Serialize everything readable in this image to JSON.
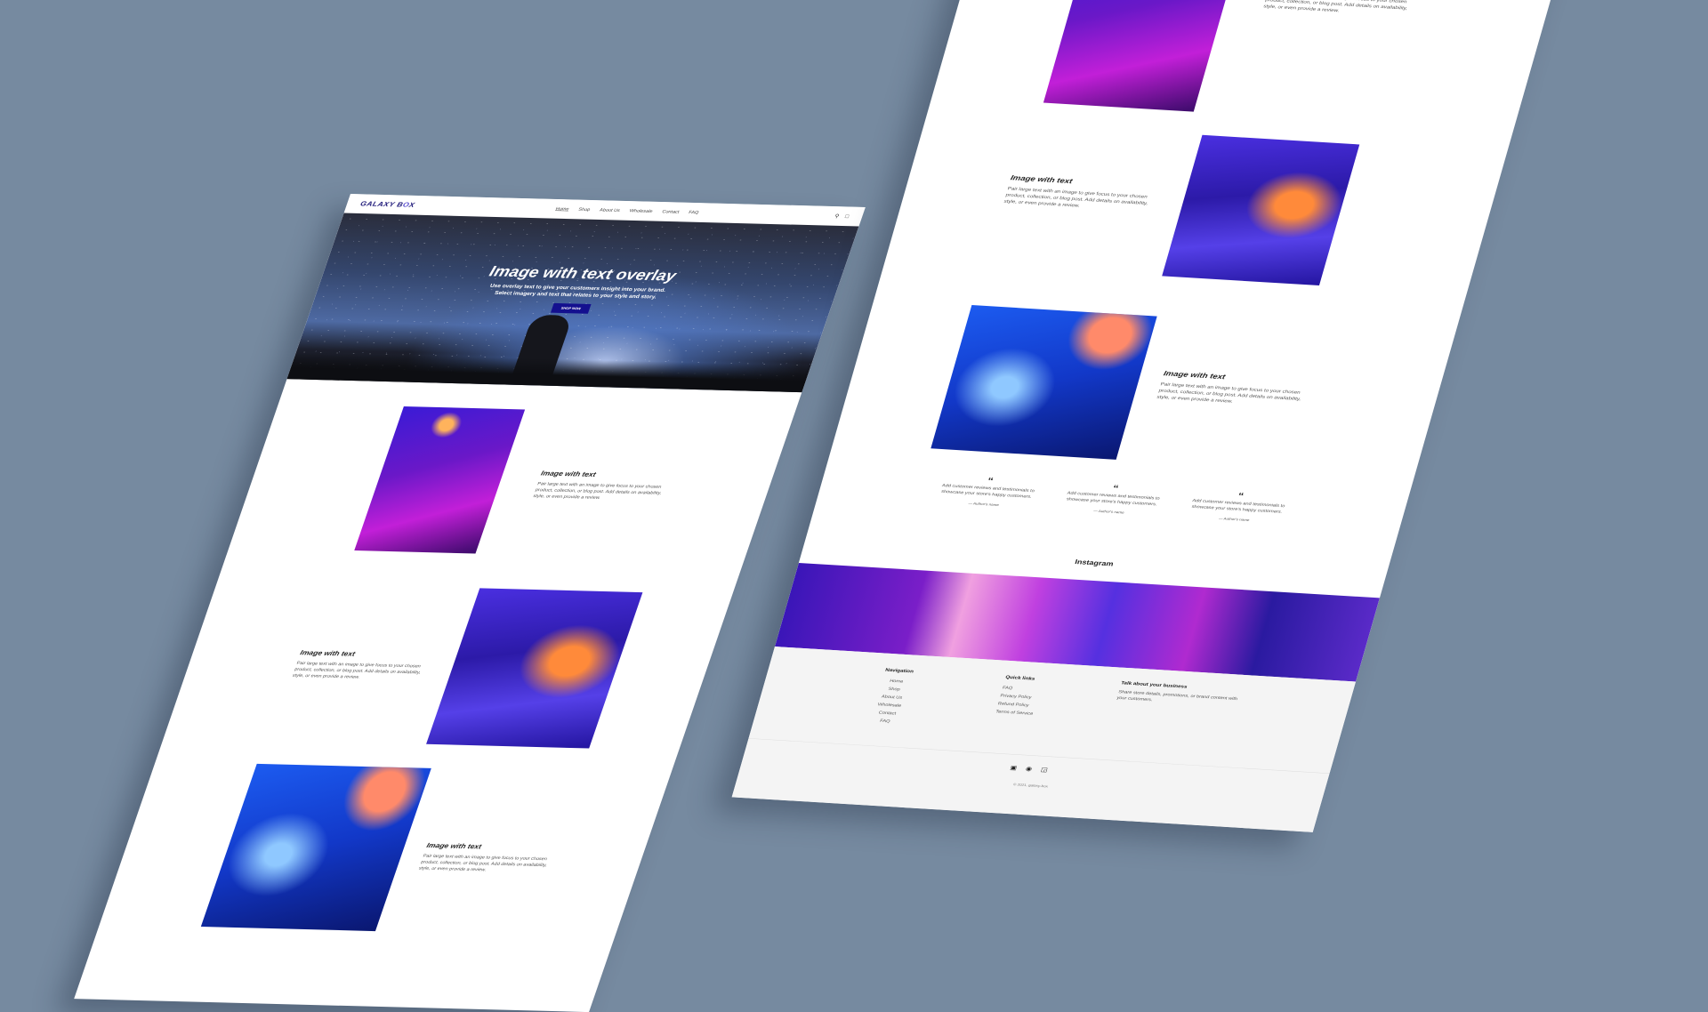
{
  "colors": {
    "background": "#768aa0",
    "brand": "#1f1a7a",
    "button": "#14108f"
  },
  "header": {
    "logo_main": "GALAXY B",
    "logo_o": "O",
    "logo_end": "X",
    "nav": [
      "Home",
      "Shop",
      "About Us",
      "Wholesale",
      "Contact",
      "FAQ"
    ],
    "icons": [
      "search-icon",
      "cart-icon"
    ]
  },
  "hero": {
    "title": "Image with text overlay",
    "subtitle": "Use overlay text to give your customers insight into your brand. Select imagery and text that relates to your style and story.",
    "button": "SHOP NOW"
  },
  "image_with_text": {
    "title": "Image with text",
    "body": "Pair large text with an image to give focus to your chosen product, collection, or blog post. Add details on availability, style, or even provide a review."
  },
  "testimonials": [
    {
      "quote_mark": "“",
      "text": "Add customer reviews and testimonials to showcase your store's happy customers.",
      "author": "— Author's name"
    },
    {
      "quote_mark": "“",
      "text": "Add customer reviews and testimonials to showcase your store's happy customers.",
      "author": "— Author's name"
    },
    {
      "quote_mark": "“",
      "text": "Add customer reviews and testimonials to showcase your store's happy customers.",
      "author": "— Author's name"
    }
  ],
  "instagram": {
    "title": "Instagram"
  },
  "footer": {
    "navigation": {
      "heading": "Navigation",
      "links": [
        "Home",
        "Shop",
        "About Us",
        "Wholesale",
        "Contact",
        "FAQ"
      ]
    },
    "quick_links": {
      "heading": "Quick links",
      "links": [
        "FAQ",
        "Privacy Policy",
        "Refund Policy",
        "Terms of Service"
      ]
    },
    "about": {
      "heading": "Talk about your business",
      "text": "Share store details, promotions, or brand content with your customers."
    },
    "social": [
      "facebook-icon",
      "pinterest-icon",
      "instagram-icon"
    ],
    "copyright": "© 2021, galaxy-box"
  }
}
